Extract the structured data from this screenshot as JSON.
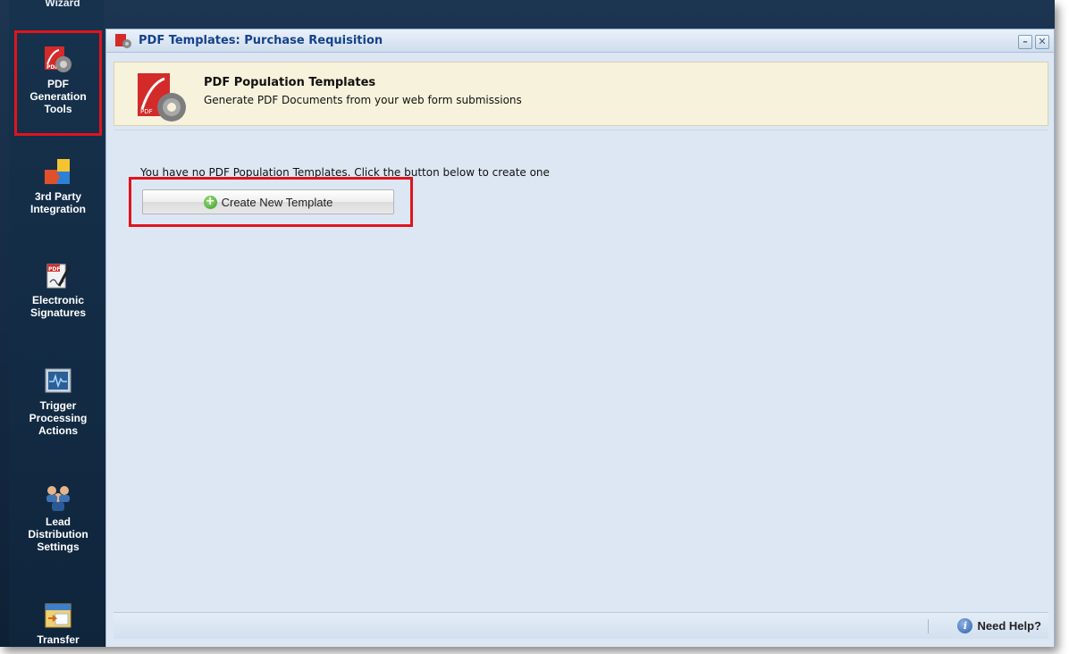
{
  "rail": {
    "top_clipped_label": "Wizard",
    "items": [
      {
        "label_lines": [
          "PDF",
          "Generation",
          "Tools"
        ],
        "icon": "pdf-gear-icon",
        "selected": true
      },
      {
        "label_lines": [
          "3rd Party",
          "Integration"
        ],
        "icon": "puzzle-icon",
        "selected": false
      },
      {
        "label_lines": [
          "Electronic",
          "Signatures"
        ],
        "icon": "pdf-signature-icon",
        "selected": false
      },
      {
        "label_lines": [
          "Trigger",
          "Processing",
          "Actions"
        ],
        "icon": "monitor-pulse-icon",
        "selected": false
      },
      {
        "label_lines": [
          "Lead",
          "Distribution",
          "Settings"
        ],
        "icon": "people-group-icon",
        "selected": false
      },
      {
        "label_lines": [
          "Transfer"
        ],
        "icon": "transfer-calendar-icon",
        "selected": false
      }
    ]
  },
  "window": {
    "title": "PDF Templates: Purchase Requisition",
    "minimize_glyph": "–",
    "close_glyph": "✕"
  },
  "banner": {
    "title": "PDF Population Templates",
    "subtitle": "Generate PDF Documents from your web form submissions"
  },
  "content": {
    "empty_message": "You have no PDF Population Templates. Click the button below to create one",
    "create_button_label": "Create New Template"
  },
  "statusbar": {
    "help_label": "Need Help?"
  },
  "colors": {
    "highlight": "#e0141e",
    "title_text": "#15428b",
    "banner_bg": "#f6f2dc"
  }
}
